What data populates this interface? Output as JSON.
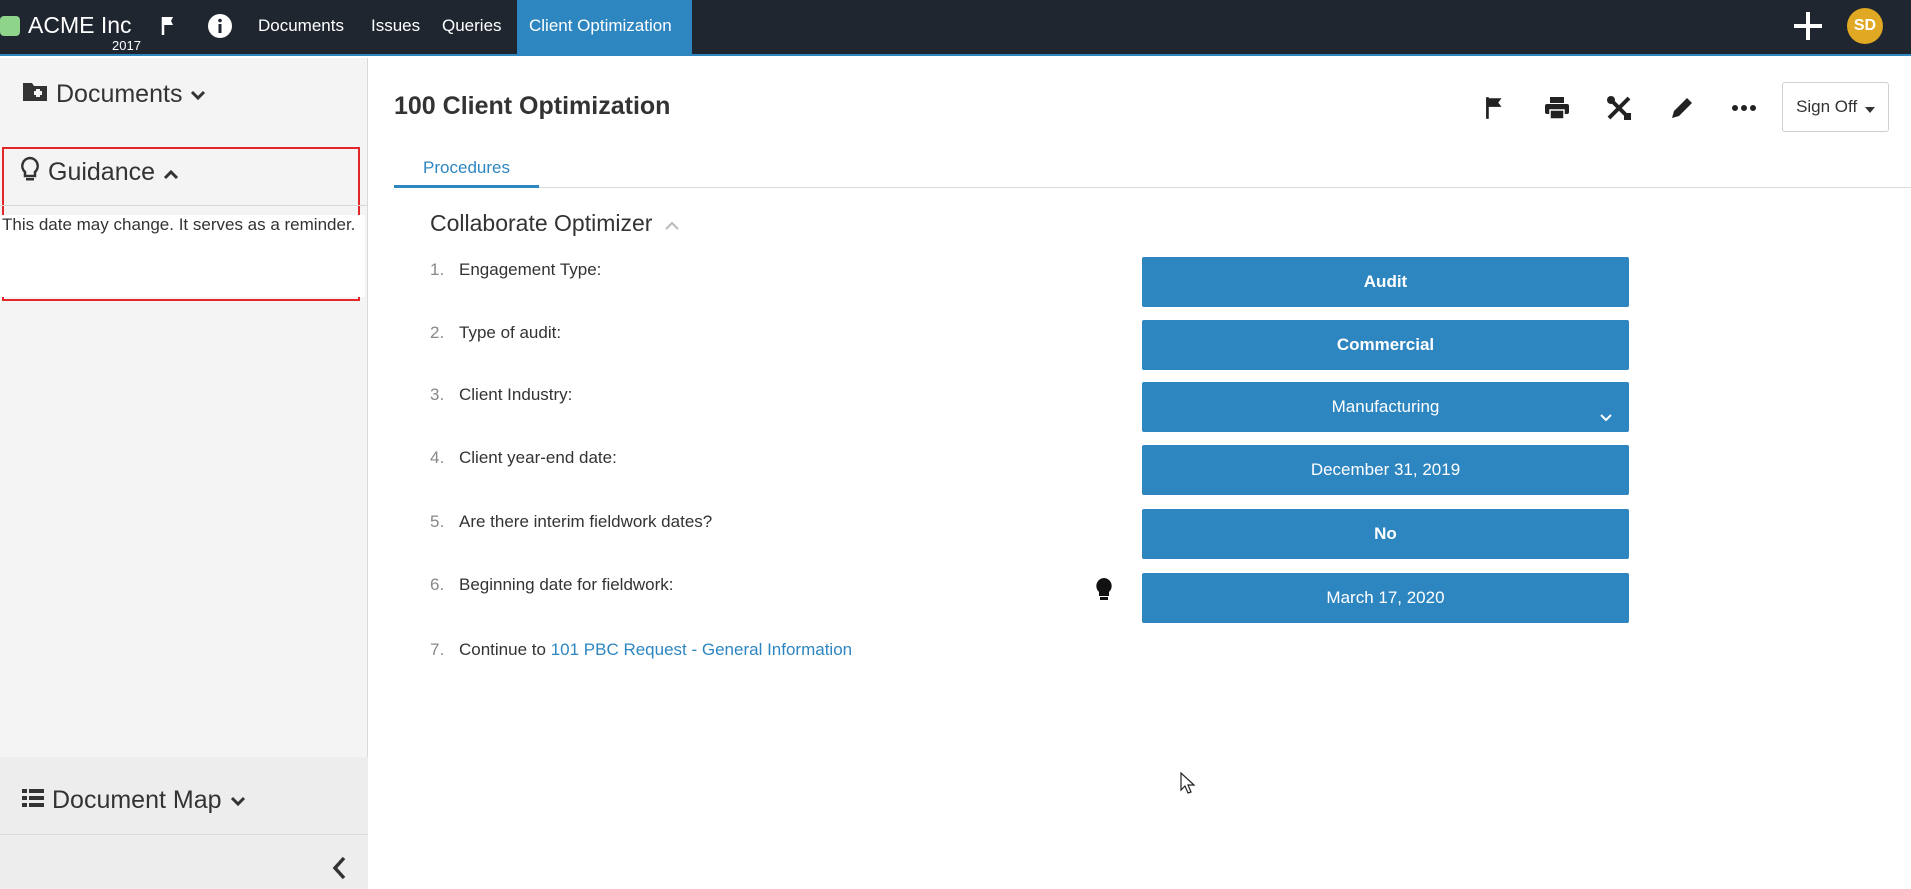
{
  "topnav": {
    "brand_name": "ACME Inc",
    "brand_year": "2017",
    "links": [
      "Documents",
      "Issues",
      "Queries",
      "Client Optimization"
    ],
    "active_link": "Client Optimization",
    "avatar_initials": "SD",
    "icons": [
      "flag-icon",
      "info-icon",
      "plus-icon"
    ]
  },
  "sidebar": {
    "documents_label": "Documents",
    "guidance_label": "Guidance",
    "guidance_text": "This date may change. It serves as a reminder.",
    "document_map_label": "Document Map"
  },
  "main": {
    "title": "100 Client Optimization",
    "signoff_label": "Sign Off",
    "tab_label": "Procedures",
    "section_title": "Collaborate Optimizer",
    "toolbar_icons": [
      "flag-icon",
      "print-icon",
      "tools-icon",
      "pencil-icon",
      "more-icon"
    ]
  },
  "questions": [
    {
      "num": "1.",
      "text": "Engagement Type:",
      "answer": "Audit"
    },
    {
      "num": "2.",
      "text": "Type of audit:",
      "answer": "Commercial"
    },
    {
      "num": "3.",
      "text": "Client Industry:",
      "answer": "Manufacturing"
    },
    {
      "num": "4.",
      "text": "Client year-end date:",
      "answer": "December 31, 2019"
    },
    {
      "num": "5.",
      "text": "Are there interim fieldwork dates?",
      "answer": "No"
    },
    {
      "num": "6.",
      "text": "Beginning date for fieldwork:",
      "answer": "March 17, 2020"
    },
    {
      "num": "7.",
      "text": "Continue to ",
      "link": "101 PBC Request - General Information"
    }
  ],
  "colors": {
    "nav_bg": "#1f2630",
    "accent": "#2e86c1",
    "avatar": "#e0a823",
    "highlight_border": "#e3262a"
  }
}
